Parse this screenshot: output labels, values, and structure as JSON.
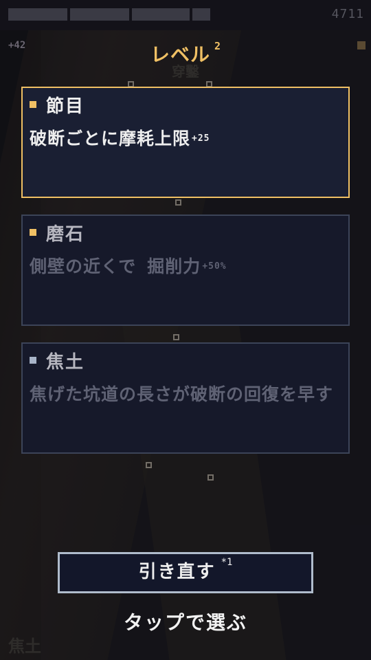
{
  "hud": {
    "number": "4711",
    "side_score": "+42"
  },
  "title": {
    "label": "レベル",
    "level": "2"
  },
  "subtitle": "穿鑿",
  "cards": [
    {
      "title": "節目",
      "desc": "破断ごとに摩耗上限",
      "bonus": "+25",
      "selected": true
    },
    {
      "title": "磨石",
      "desc": "側壁の近くで 掘削力",
      "bonus": "+50%",
      "selected": false
    },
    {
      "title": "焦土",
      "desc": "焦げた坑道の長さが破断の回復を早す",
      "bonus": "",
      "selected": false
    }
  ],
  "reroll": {
    "label": "引き直す",
    "count": "*1"
  },
  "hint": "タップで選ぶ",
  "corner_text": "焦土",
  "colors": {
    "accent": "#f0c064",
    "card_bg": "#16192a",
    "card_border": "#3c4458"
  }
}
